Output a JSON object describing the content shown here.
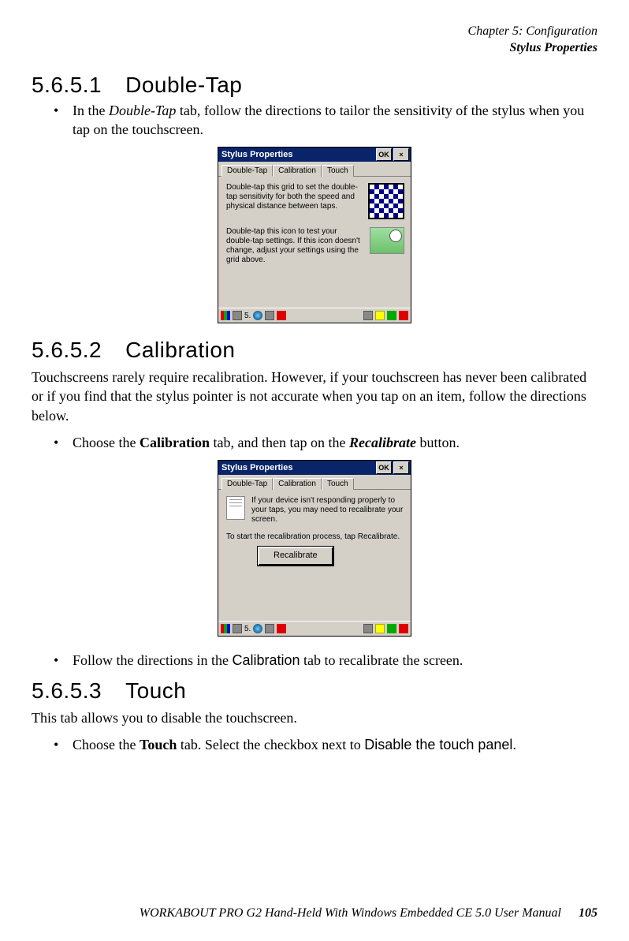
{
  "header": {
    "chapter": "Chapter 5: Configuration",
    "section": "Stylus Properties"
  },
  "s1": {
    "num": "5.6.5.1",
    "title": "Double-Tap",
    "bullet_pre": "In the ",
    "bullet_em": "Double-Tap",
    "bullet_post": " tab, follow the directions to tailor the sensitivity of the stylus when you tap on the touchscreen."
  },
  "win1": {
    "title": "Stylus Properties",
    "ok": "OK",
    "tabs": {
      "t1": "Double-Tap",
      "t2": "Calibration",
      "t3": "Touch"
    },
    "text1": "Double-tap this grid to set the double-tap sensitivity for both the speed and physical distance between taps.",
    "text2": "Double-tap this icon to test your double-tap settings. If this icon doesn't change, adjust your settings using the grid above.",
    "taskbar_num": "5."
  },
  "s2": {
    "num": "5.6.5.2",
    "title": "Calibration",
    "para": "Touchscreens rarely require recalibration. However, if your touchscreen has never been calibrated or if you find that the stylus pointer is not accurate when you tap on an item, follow the directions below.",
    "b1_pre": "Choose the ",
    "b1_bold": "Calibration",
    "b1_mid": " tab, and then tap on the ",
    "b1_bi": "Recalibrate",
    "b1_post": " button.",
    "b2_pre": "Follow the directions in the ",
    "b2_sans": "Calibration",
    "b2_post": " tab to recalibrate the screen."
  },
  "win2": {
    "title": "Stylus Properties",
    "ok": "OK",
    "tabs": {
      "t1": "Double-Tap",
      "t2": "Calibration",
      "t3": "Touch"
    },
    "text1": "If your device isn't responding properly to your taps, you may need to recalibrate your screen.",
    "text2": "To start the recalibration process, tap Recalibrate.",
    "button": "Recalibrate",
    "taskbar_num": "5."
  },
  "s3": {
    "num": "5.6.5.3",
    "title": "Touch",
    "para": "This tab allows you to disable the touchscreen.",
    "b1_pre": "Choose the ",
    "b1_bold": "Touch",
    "b1_mid": " tab. Select the checkbox next to ",
    "b1_sans": "Disable the touch panel",
    "b1_post": "."
  },
  "footer": {
    "text": "WORKABOUT PRO G2 Hand-Held With Windows Embedded CE 5.0 User Manual",
    "page": "105"
  }
}
